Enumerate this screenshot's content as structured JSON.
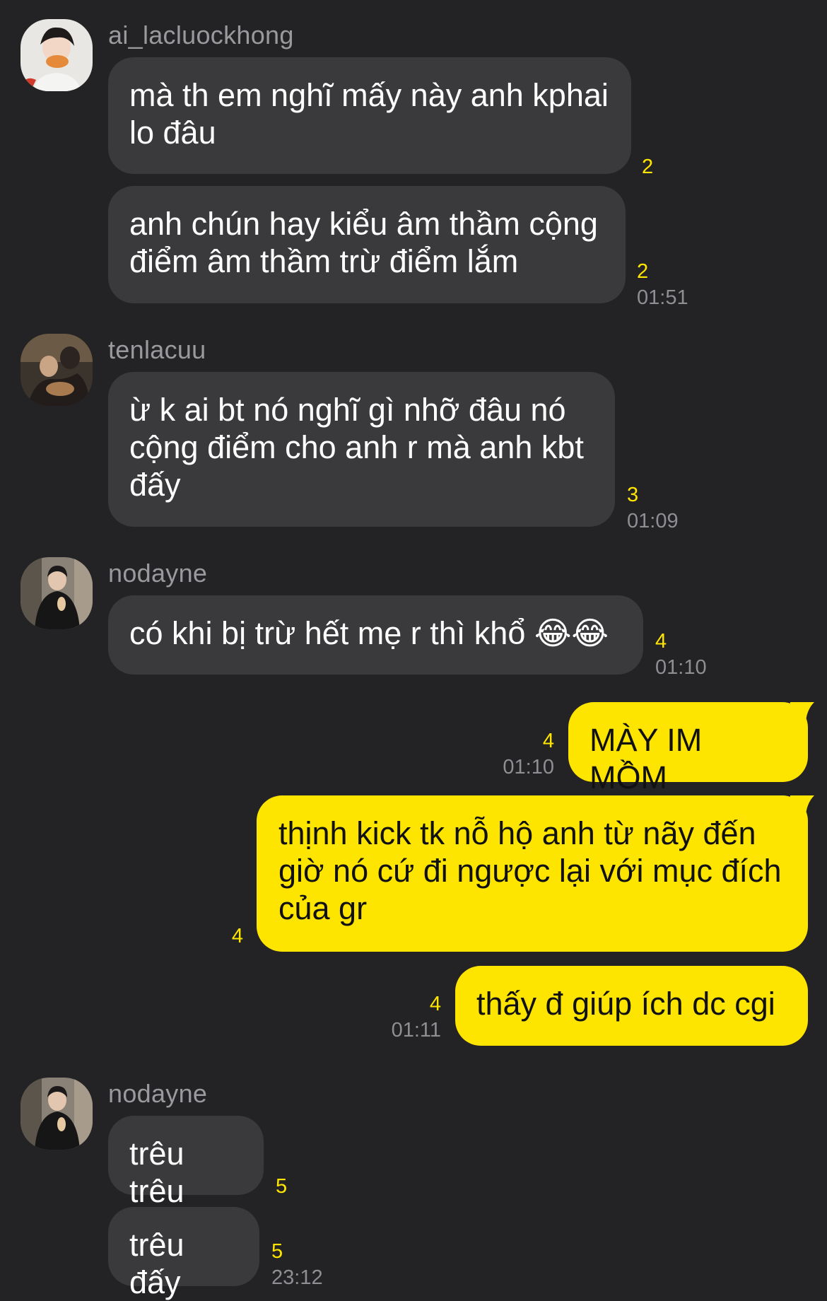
{
  "messages": [
    {
      "sender": "ai_lacluockhong",
      "text": "mà th em nghĩ mấy này anh kphai lo đâu",
      "unread": "2",
      "time": ""
    },
    {
      "sender": "ai_lacluockhong",
      "text": "anh chún hay kiểu âm thầm cộng điểm âm thầm trừ điểm lắm",
      "unread": "2",
      "time": "01:51"
    },
    {
      "sender": "tenlacuu",
      "text": "ừ k ai bt nó nghĩ gì nhỡ đâu nó cộng điểm cho anh r mà anh kbt đấy",
      "unread": "3",
      "time": "01:09"
    },
    {
      "sender": "nodayne",
      "text": "có khi bị trừ hết mẹ r thì khổ 😂😂",
      "unread": "4",
      "time": "01:10"
    },
    {
      "sender": "me",
      "text": "MÀY IM MỒM",
      "unread": "4",
      "time": "01:10"
    },
    {
      "sender": "me",
      "text": "thịnh kick tk nỗ hộ anh từ nãy đến giờ nó cứ đi ngược lại với mục đích của gr",
      "unread": "4",
      "time": ""
    },
    {
      "sender": "me",
      "text": "thấy đ giúp ích dc cgi",
      "unread": "4",
      "time": "01:11"
    },
    {
      "sender": "nodayne",
      "text": "trêu trêu",
      "unread": "5",
      "time": ""
    },
    {
      "sender": "nodayne",
      "text": "trêu đấy",
      "unread": "5",
      "time": "23:12"
    }
  ],
  "colors": {
    "background": "#232325",
    "incoming": "#3a3a3c",
    "outgoing": "#fee500",
    "unread": "#fee500",
    "time": "#8e8e93"
  }
}
